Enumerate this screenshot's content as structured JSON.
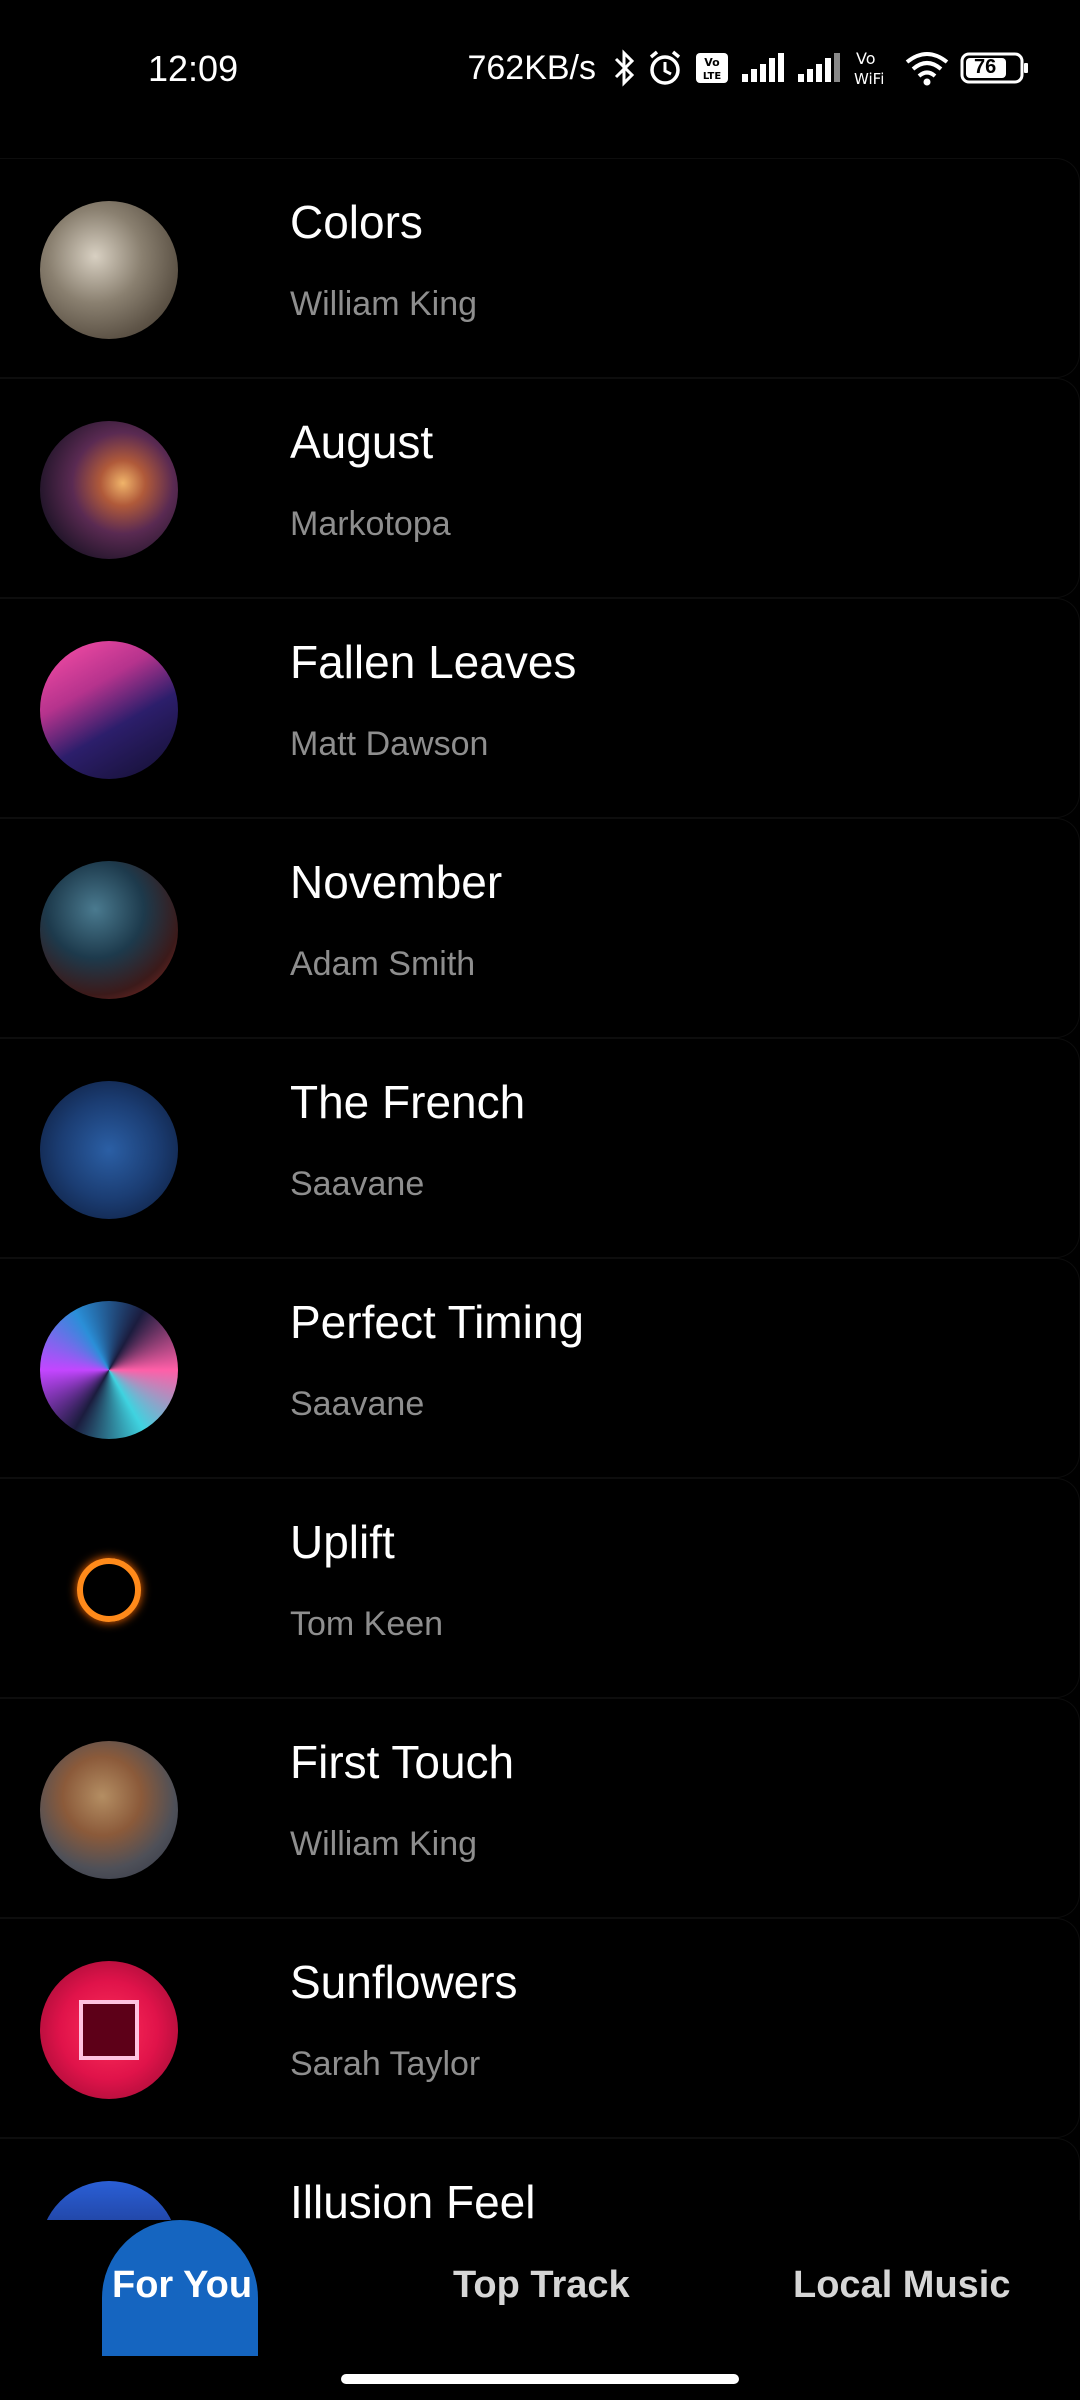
{
  "status_bar": {
    "time": "12:09",
    "speed": "762KB/s",
    "battery": "76",
    "icons": [
      "bluetooth-icon",
      "alarm-icon",
      "volte-icon",
      "signal-icon",
      "signal-icon",
      "vowifi-icon",
      "wifi-icon",
      "battery-icon"
    ]
  },
  "tracks": [
    {
      "title": "Colors",
      "artist": "William King"
    },
    {
      "title": "August",
      "artist": "Markotopa"
    },
    {
      "title": "Fallen Leaves",
      "artist": "Matt Dawson"
    },
    {
      "title": "November",
      "artist": "Adam Smith"
    },
    {
      "title": "The French",
      "artist": "Saavane"
    },
    {
      "title": "Perfect Timing",
      "artist": "Saavane"
    },
    {
      "title": "Uplift",
      "artist": "Tom Keen"
    },
    {
      "title": "First Touch",
      "artist": "William King"
    },
    {
      "title": "Sunflowers",
      "artist": "Sarah Taylor"
    },
    {
      "title": "Illusion Feel",
      "artist": ""
    }
  ],
  "nav": {
    "for_you": "For You",
    "top_track": "Top Track",
    "local_music": "Local Music",
    "active": "For You"
  },
  "colors": {
    "accent": "#1565c0",
    "background": "#000000",
    "artist_text": "#8e8e8e"
  }
}
